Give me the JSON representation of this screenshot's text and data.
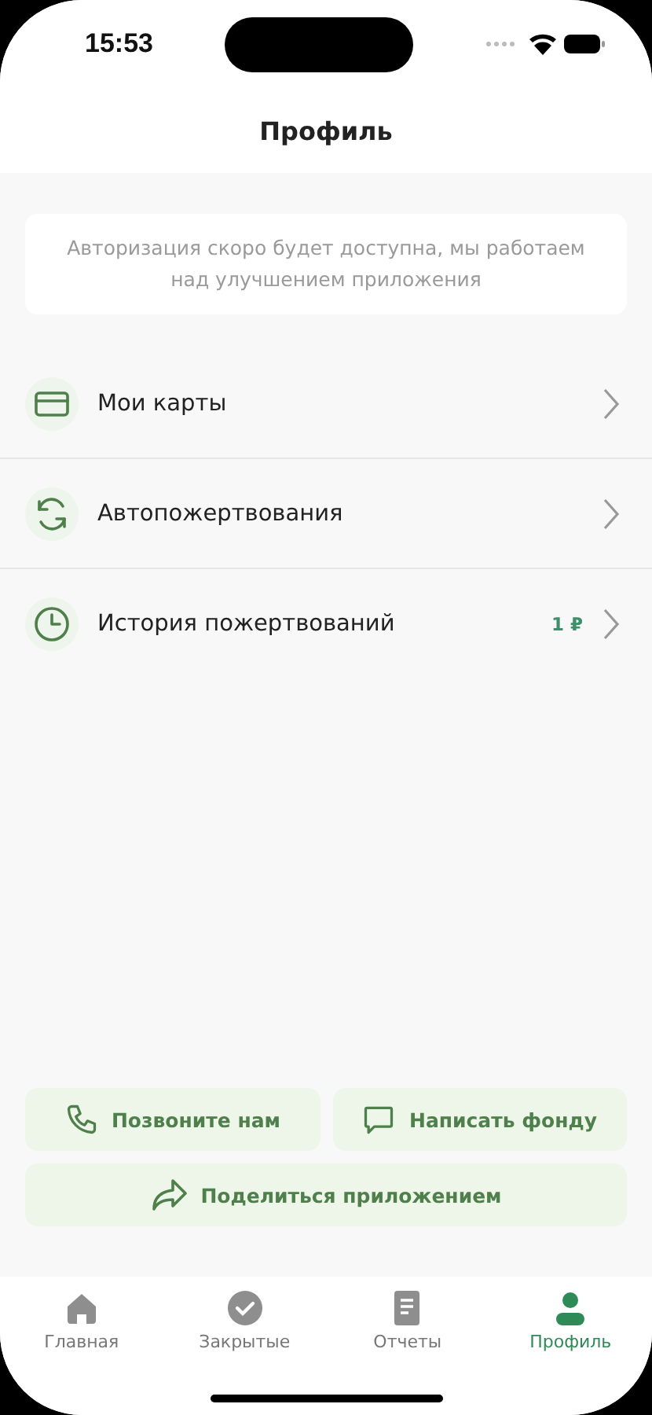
{
  "status_bar": {
    "time": "15:53"
  },
  "header": {
    "title": "Профиль"
  },
  "notice": "Авторизация скоро будет доступна, мы работаем над улучшением приложения",
  "menu": [
    {
      "label": "Мои карты"
    },
    {
      "label": "Автопожертвования"
    },
    {
      "label": "История пожертвований",
      "amount": "1 ₽"
    }
  ],
  "contact_buttons": [
    {
      "label": "Позвоните нам"
    },
    {
      "label": "Написать фонду"
    }
  ],
  "share_button": {
    "label": "Поделиться приложением"
  },
  "tab_bar": [
    {
      "label": "Главная",
      "selected": false
    },
    {
      "label": "Закрытые",
      "selected": false
    },
    {
      "label": "Отчеты",
      "selected": false
    },
    {
      "label": "Профиль",
      "selected": true
    }
  ]
}
